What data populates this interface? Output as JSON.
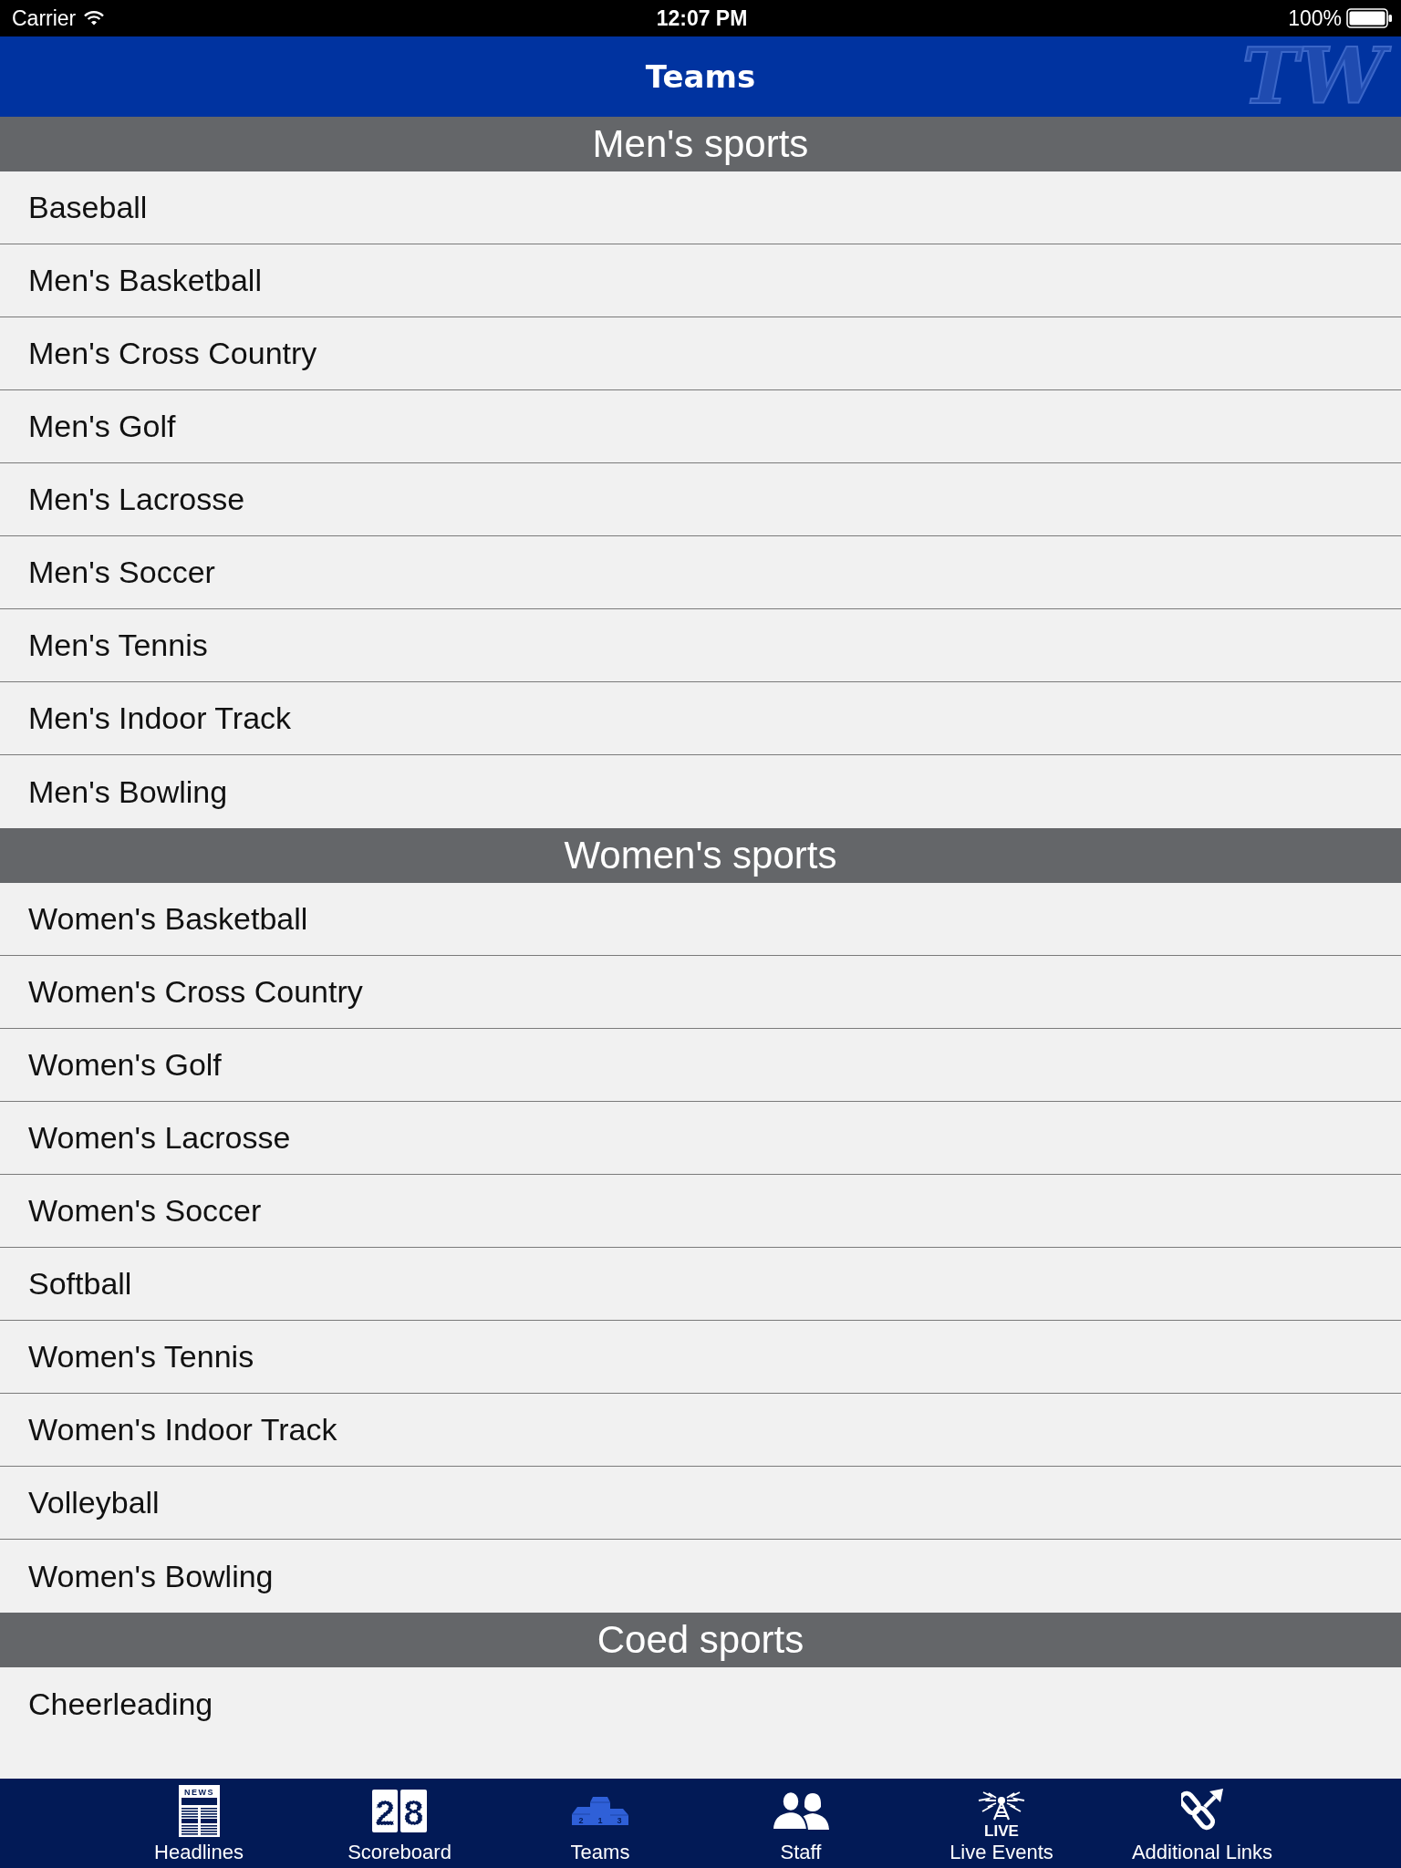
{
  "status_bar": {
    "carrier": "Carrier",
    "time": "12:07 PM",
    "battery": "100%"
  },
  "header": {
    "title": "Teams",
    "logo": "TW"
  },
  "sections": [
    {
      "title": "Men's sports",
      "items": [
        "Baseball",
        "Men's Basketball",
        "Men's Cross Country",
        "Men's Golf",
        "Men's Lacrosse",
        "Men's Soccer",
        "Men's Tennis",
        "Men's Indoor Track",
        "Men's Bowling"
      ]
    },
    {
      "title": "Women's sports",
      "items": [
        "Women's Basketball",
        "Women's Cross Country",
        "Women's Golf",
        "Women's Lacrosse",
        "Women's Soccer",
        "Softball",
        "Women's Tennis",
        "Women's Indoor Track",
        "Volleyball",
        "Women's Bowling"
      ]
    },
    {
      "title": "Coed sports",
      "items": [
        "Cheerleading"
      ]
    }
  ],
  "tab_bar": [
    {
      "label": "Headlines",
      "kind": "news",
      "icon_text": [
        "NEWS"
      ],
      "selected": false
    },
    {
      "label": "Scoreboard",
      "kind": "scoreboard",
      "icon_text": [
        "2",
        "8"
      ],
      "selected": false
    },
    {
      "label": "Teams",
      "kind": "podium",
      "icon_text": [
        "2",
        "1",
        "3"
      ],
      "selected": true
    },
    {
      "label": "Staff",
      "kind": "staff",
      "selected": false
    },
    {
      "label": "Live Events",
      "kind": "live",
      "icon_text": [
        "LIVE"
      ],
      "selected": false
    },
    {
      "label": "Additional Links",
      "kind": "links",
      "selected": false
    }
  ]
}
